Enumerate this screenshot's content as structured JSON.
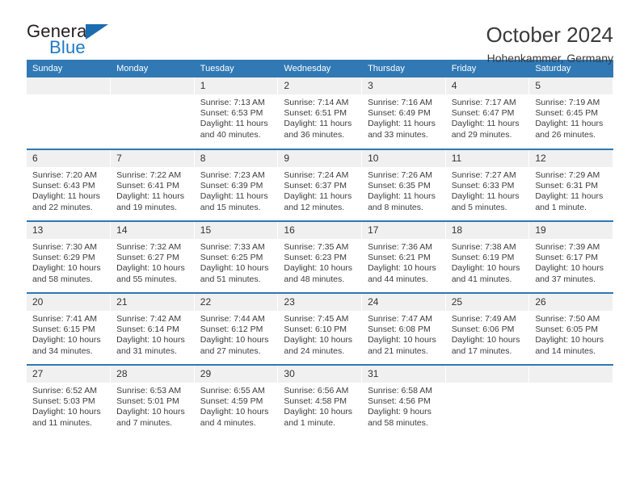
{
  "brand": {
    "name_part1": "General",
    "name_part2": "Blue",
    "accent_color": "#1c6cb0"
  },
  "header": {
    "title": "October 2024",
    "subtitle": "Hohenkammer, Germany"
  },
  "calendar": {
    "header_background": "#3079b5",
    "daynum_background": "#f0f0f0",
    "weekday_headers": [
      "Sunday",
      "Monday",
      "Tuesday",
      "Wednesday",
      "Thursday",
      "Friday",
      "Saturday"
    ],
    "weeks": [
      [
        {
          "day": "",
          "sunrise": "",
          "sunset": "",
          "daylight": ""
        },
        {
          "day": "",
          "sunrise": "",
          "sunset": "",
          "daylight": ""
        },
        {
          "day": "1",
          "sunrise": "Sunrise: 7:13 AM",
          "sunset": "Sunset: 6:53 PM",
          "daylight": "Daylight: 11 hours and 40 minutes."
        },
        {
          "day": "2",
          "sunrise": "Sunrise: 7:14 AM",
          "sunset": "Sunset: 6:51 PM",
          "daylight": "Daylight: 11 hours and 36 minutes."
        },
        {
          "day": "3",
          "sunrise": "Sunrise: 7:16 AM",
          "sunset": "Sunset: 6:49 PM",
          "daylight": "Daylight: 11 hours and 33 minutes."
        },
        {
          "day": "4",
          "sunrise": "Sunrise: 7:17 AM",
          "sunset": "Sunset: 6:47 PM",
          "daylight": "Daylight: 11 hours and 29 minutes."
        },
        {
          "day": "5",
          "sunrise": "Sunrise: 7:19 AM",
          "sunset": "Sunset: 6:45 PM",
          "daylight": "Daylight: 11 hours and 26 minutes."
        }
      ],
      [
        {
          "day": "6",
          "sunrise": "Sunrise: 7:20 AM",
          "sunset": "Sunset: 6:43 PM",
          "daylight": "Daylight: 11 hours and 22 minutes."
        },
        {
          "day": "7",
          "sunrise": "Sunrise: 7:22 AM",
          "sunset": "Sunset: 6:41 PM",
          "daylight": "Daylight: 11 hours and 19 minutes."
        },
        {
          "day": "8",
          "sunrise": "Sunrise: 7:23 AM",
          "sunset": "Sunset: 6:39 PM",
          "daylight": "Daylight: 11 hours and 15 minutes."
        },
        {
          "day": "9",
          "sunrise": "Sunrise: 7:24 AM",
          "sunset": "Sunset: 6:37 PM",
          "daylight": "Daylight: 11 hours and 12 minutes."
        },
        {
          "day": "10",
          "sunrise": "Sunrise: 7:26 AM",
          "sunset": "Sunset: 6:35 PM",
          "daylight": "Daylight: 11 hours and 8 minutes."
        },
        {
          "day": "11",
          "sunrise": "Sunrise: 7:27 AM",
          "sunset": "Sunset: 6:33 PM",
          "daylight": "Daylight: 11 hours and 5 minutes."
        },
        {
          "day": "12",
          "sunrise": "Sunrise: 7:29 AM",
          "sunset": "Sunset: 6:31 PM",
          "daylight": "Daylight: 11 hours and 1 minute."
        }
      ],
      [
        {
          "day": "13",
          "sunrise": "Sunrise: 7:30 AM",
          "sunset": "Sunset: 6:29 PM",
          "daylight": "Daylight: 10 hours and 58 minutes."
        },
        {
          "day": "14",
          "sunrise": "Sunrise: 7:32 AM",
          "sunset": "Sunset: 6:27 PM",
          "daylight": "Daylight: 10 hours and 55 minutes."
        },
        {
          "day": "15",
          "sunrise": "Sunrise: 7:33 AM",
          "sunset": "Sunset: 6:25 PM",
          "daylight": "Daylight: 10 hours and 51 minutes."
        },
        {
          "day": "16",
          "sunrise": "Sunrise: 7:35 AM",
          "sunset": "Sunset: 6:23 PM",
          "daylight": "Daylight: 10 hours and 48 minutes."
        },
        {
          "day": "17",
          "sunrise": "Sunrise: 7:36 AM",
          "sunset": "Sunset: 6:21 PM",
          "daylight": "Daylight: 10 hours and 44 minutes."
        },
        {
          "day": "18",
          "sunrise": "Sunrise: 7:38 AM",
          "sunset": "Sunset: 6:19 PM",
          "daylight": "Daylight: 10 hours and 41 minutes."
        },
        {
          "day": "19",
          "sunrise": "Sunrise: 7:39 AM",
          "sunset": "Sunset: 6:17 PM",
          "daylight": "Daylight: 10 hours and 37 minutes."
        }
      ],
      [
        {
          "day": "20",
          "sunrise": "Sunrise: 7:41 AM",
          "sunset": "Sunset: 6:15 PM",
          "daylight": "Daylight: 10 hours and 34 minutes."
        },
        {
          "day": "21",
          "sunrise": "Sunrise: 7:42 AM",
          "sunset": "Sunset: 6:14 PM",
          "daylight": "Daylight: 10 hours and 31 minutes."
        },
        {
          "day": "22",
          "sunrise": "Sunrise: 7:44 AM",
          "sunset": "Sunset: 6:12 PM",
          "daylight": "Daylight: 10 hours and 27 minutes."
        },
        {
          "day": "23",
          "sunrise": "Sunrise: 7:45 AM",
          "sunset": "Sunset: 6:10 PM",
          "daylight": "Daylight: 10 hours and 24 minutes."
        },
        {
          "day": "24",
          "sunrise": "Sunrise: 7:47 AM",
          "sunset": "Sunset: 6:08 PM",
          "daylight": "Daylight: 10 hours and 21 minutes."
        },
        {
          "day": "25",
          "sunrise": "Sunrise: 7:49 AM",
          "sunset": "Sunset: 6:06 PM",
          "daylight": "Daylight: 10 hours and 17 minutes."
        },
        {
          "day": "26",
          "sunrise": "Sunrise: 7:50 AM",
          "sunset": "Sunset: 6:05 PM",
          "daylight": "Daylight: 10 hours and 14 minutes."
        }
      ],
      [
        {
          "day": "27",
          "sunrise": "Sunrise: 6:52 AM",
          "sunset": "Sunset: 5:03 PM",
          "daylight": "Daylight: 10 hours and 11 minutes."
        },
        {
          "day": "28",
          "sunrise": "Sunrise: 6:53 AM",
          "sunset": "Sunset: 5:01 PM",
          "daylight": "Daylight: 10 hours and 7 minutes."
        },
        {
          "day": "29",
          "sunrise": "Sunrise: 6:55 AM",
          "sunset": "Sunset: 4:59 PM",
          "daylight": "Daylight: 10 hours and 4 minutes."
        },
        {
          "day": "30",
          "sunrise": "Sunrise: 6:56 AM",
          "sunset": "Sunset: 4:58 PM",
          "daylight": "Daylight: 10 hours and 1 minute."
        },
        {
          "day": "31",
          "sunrise": "Sunrise: 6:58 AM",
          "sunset": "Sunset: 4:56 PM",
          "daylight": "Daylight: 9 hours and 58 minutes."
        },
        {
          "day": "",
          "sunrise": "",
          "sunset": "",
          "daylight": ""
        },
        {
          "day": "",
          "sunrise": "",
          "sunset": "",
          "daylight": ""
        }
      ]
    ]
  }
}
